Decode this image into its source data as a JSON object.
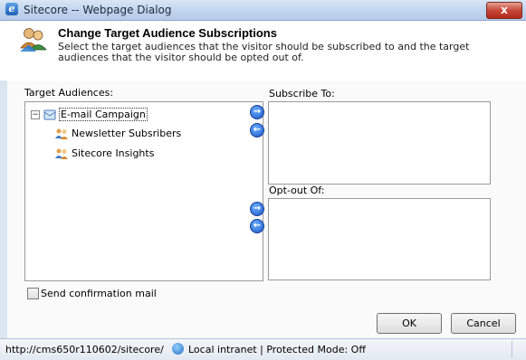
{
  "window": {
    "title": "Sitecore -- Webpage Dialog",
    "close_label": "x"
  },
  "header": {
    "title": "Change Target Audience Subscriptions",
    "description": "Select the target audiences that the visitor should be subscribed to and the target audiences that the visitor should be opted out of."
  },
  "audiences": {
    "label": "Target Audiences:",
    "root": {
      "expander": "−",
      "label": "E-mail Campaign"
    },
    "children": [
      {
        "label": "Newsletter Subsribers"
      },
      {
        "label": "Sitecore Insights"
      }
    ]
  },
  "subscribe": {
    "label": "Subscribe To:"
  },
  "optout": {
    "label": "Opt-out Of:"
  },
  "confirmation": {
    "label": "Send confirmation mail",
    "checked": false
  },
  "buttons": {
    "ok": "OK",
    "cancel": "Cancel"
  },
  "statusbar": {
    "url": "http://cms650r110602/sitecore/",
    "zone": "Local intranet | Protected Mode: Off"
  },
  "colors": {
    "titlebar": "#c3d6ee",
    "close": "#c7483a",
    "arrow": "#1b55c7",
    "statusbar": "#e3e9f1"
  },
  "icons": {
    "title": "ie-icon",
    "header": "users-icon",
    "arrows": [
      "arrow-right-icon",
      "arrow-left-icon"
    ],
    "status": "globe-icon"
  }
}
